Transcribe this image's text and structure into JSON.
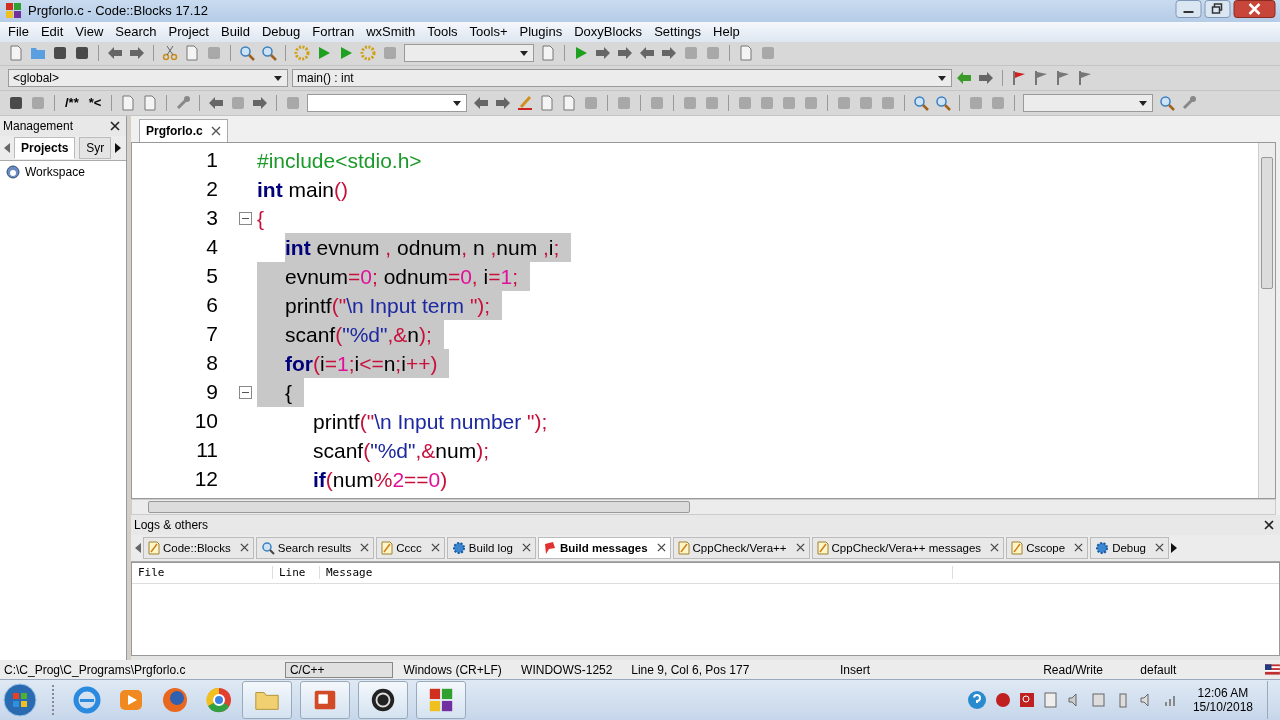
{
  "window": {
    "title": "Prgforlo.c - Code::Blocks 17.12"
  },
  "menu": [
    "File",
    "Edit",
    "View",
    "Search",
    "Project",
    "Build",
    "Debug",
    "Fortran",
    "wxSmith",
    "Tools",
    "Tools+",
    "Plugins",
    "DoxyBlocks",
    "Settings",
    "Help"
  ],
  "scope_bar": {
    "scope": "<global>",
    "function": "main() : int"
  },
  "comment_tools": [
    "/**",
    "*<"
  ],
  "management": {
    "title": "Management",
    "tabs": [
      {
        "label": "Projects",
        "selected": true
      },
      {
        "label": "Syr",
        "selected": false
      }
    ],
    "tree": [
      {
        "label": "Workspace"
      }
    ]
  },
  "editor": {
    "tabs": [
      {
        "label": "Prgforlo.c",
        "selected": true
      }
    ],
    "lines": [
      {
        "number": "1",
        "selected": false,
        "tokens": [
          {
            "t": "#include<stdio.h>",
            "kind": "pre"
          }
        ]
      },
      {
        "number": "2",
        "selected": false,
        "tokens": [
          {
            "t": "int",
            "kind": "kw"
          },
          {
            "t": " main",
            "kind": "id"
          },
          {
            "t": "()",
            "kind": "op"
          }
        ]
      },
      {
        "number": "3",
        "selected": false,
        "tokens": [
          {
            "t": "{",
            "kind": "op"
          }
        ],
        "children": [
          {
            "number": "4",
            "selected": true,
            "tokens": [
              {
                "t": "int",
                "kind": "kw"
              },
              {
                "t": " evnum ",
                "kind": "id"
              },
              {
                "t": ",",
                "kind": "op"
              },
              {
                "t": " odnum",
                "kind": "id"
              },
              {
                "t": ",",
                "kind": "op"
              },
              {
                "t": " n ",
                "kind": "id"
              },
              {
                "t": ",",
                "kind": "op"
              },
              {
                "t": "num ",
                "kind": "id"
              },
              {
                "t": ",",
                "kind": "op"
              },
              {
                "t": "i",
                "kind": "id"
              },
              {
                "t": ";",
                "kind": "op"
              }
            ]
          },
          {
            "number": "5",
            "selected": true,
            "tokens": [
              {
                "t": "evnum",
                "kind": "id"
              },
              {
                "t": "=",
                "kind": "op"
              },
              {
                "t": "0",
                "kind": "num"
              },
              {
                "t": ";",
                "kind": "op"
              },
              {
                "t": " odnum",
                "kind": "id"
              },
              {
                "t": "=",
                "kind": "op"
              },
              {
                "t": "0",
                "kind": "num"
              },
              {
                "t": ",",
                "kind": "op"
              },
              {
                "t": " i",
                "kind": "id"
              },
              {
                "t": "=",
                "kind": "op"
              },
              {
                "t": "1",
                "kind": "num"
              },
              {
                "t": ";",
                "kind": "op"
              }
            ]
          },
          {
            "number": "6",
            "selected": true,
            "tokens": [
              {
                "t": "printf",
                "kind": "id"
              },
              {
                "t": "(\"",
                "kind": "op"
              },
              {
                "t": "\\n Input term ",
                "kind": "str"
              },
              {
                "t": "\");",
                "kind": "op"
              }
            ]
          },
          {
            "number": "7",
            "selected": true,
            "tokens": [
              {
                "t": "scanf",
                "kind": "id"
              },
              {
                "t": "(",
                "kind": "op"
              },
              {
                "t": "\"%d\"",
                "kind": "str"
              },
              {
                "t": ",&",
                "kind": "op"
              },
              {
                "t": "n",
                "kind": "id"
              },
              {
                "t": ");",
                "kind": "op"
              }
            ]
          },
          {
            "number": "8",
            "selected": true,
            "tokens": [
              {
                "t": "for",
                "kind": "kw"
              },
              {
                "t": "(",
                "kind": "op"
              },
              {
                "t": "i",
                "kind": "id"
              },
              {
                "t": "=",
                "kind": "op"
              },
              {
                "t": "1",
                "kind": "num"
              },
              {
                "t": ";",
                "kind": "op"
              },
              {
                "t": "i",
                "kind": "id"
              },
              {
                "t": "<=",
                "kind": "op"
              },
              {
                "t": "n",
                "kind": "id"
              },
              {
                "t": ";",
                "kind": "op"
              },
              {
                "t": "i",
                "kind": "id"
              },
              {
                "t": "++)",
                "kind": "op"
              }
            ]
          },
          {
            "number": "9",
            "selected": true,
            "tokens": [
              {
                "t": "{",
                "kind": "id"
              }
            ],
            "children": [
              {
                "number": "10",
                "selected": false,
                "tokens": [
                  {
                    "t": "printf",
                    "kind": "id"
                  },
                  {
                    "t": "(\"",
                    "kind": "op"
                  },
                  {
                    "t": "\\n Input number ",
                    "kind": "str"
                  },
                  {
                    "t": "\");",
                    "kind": "op"
                  }
                ]
              },
              {
                "number": "11",
                "selected": false,
                "tokens": [
                  {
                    "t": "scanf",
                    "kind": "id"
                  },
                  {
                    "t": "(",
                    "kind": "op"
                  },
                  {
                    "t": "\"%d\"",
                    "kind": "str"
                  },
                  {
                    "t": ",&",
                    "kind": "op"
                  },
                  {
                    "t": "num",
                    "kind": "id"
                  },
                  {
                    "t": ");",
                    "kind": "op"
                  }
                ]
              },
              {
                "number": "12",
                "selected": false,
                "tokens": [
                  {
                    "t": "if",
                    "kind": "kw"
                  },
                  {
                    "t": "(",
                    "kind": "op"
                  },
                  {
                    "t": "num",
                    "kind": "id"
                  },
                  {
                    "t": "%",
                    "kind": "op"
                  },
                  {
                    "t": "2",
                    "kind": "num"
                  },
                  {
                    "t": "==",
                    "kind": "op"
                  },
                  {
                    "t": "0",
                    "kind": "num"
                  },
                  {
                    "t": ")",
                    "kind": "op"
                  }
                ]
              }
            ]
          }
        ]
      }
    ]
  },
  "logs": {
    "title": "Logs & others",
    "tabs": [
      {
        "label": "Code::Blocks",
        "kind": "note",
        "selected": false
      },
      {
        "label": "Search results",
        "kind": "search",
        "selected": false
      },
      {
        "label": "Cccc",
        "kind": "note",
        "selected": false
      },
      {
        "label": "Build log",
        "kind": "gear",
        "selected": false
      },
      {
        "label": "Build messages",
        "kind": "pin",
        "selected": true
      },
      {
        "label": "CppCheck/Vera++",
        "kind": "note",
        "selected": false
      },
      {
        "label": "CppCheck/Vera++ messages",
        "kind": "note",
        "selected": false
      },
      {
        "label": "Cscope",
        "kind": "note",
        "selected": false
      },
      {
        "label": "Debug",
        "kind": "gear",
        "selected": false
      }
    ],
    "columns": [
      "File",
      "Line",
      "Message"
    ]
  },
  "status_bar": {
    "path": "C:\\C_Prog\\C_Programs\\Prgforlo.c",
    "language": "C/C++",
    "line_endings": "Windows (CR+LF)",
    "encoding": "WINDOWS-1252",
    "position": "Line 9, Col 6, Pos 177",
    "mode": "Insert",
    "access": "Read/Write",
    "profile": "default"
  },
  "taskbar": {
    "time": "12:06 AM",
    "date": "15/10/2018"
  }
}
